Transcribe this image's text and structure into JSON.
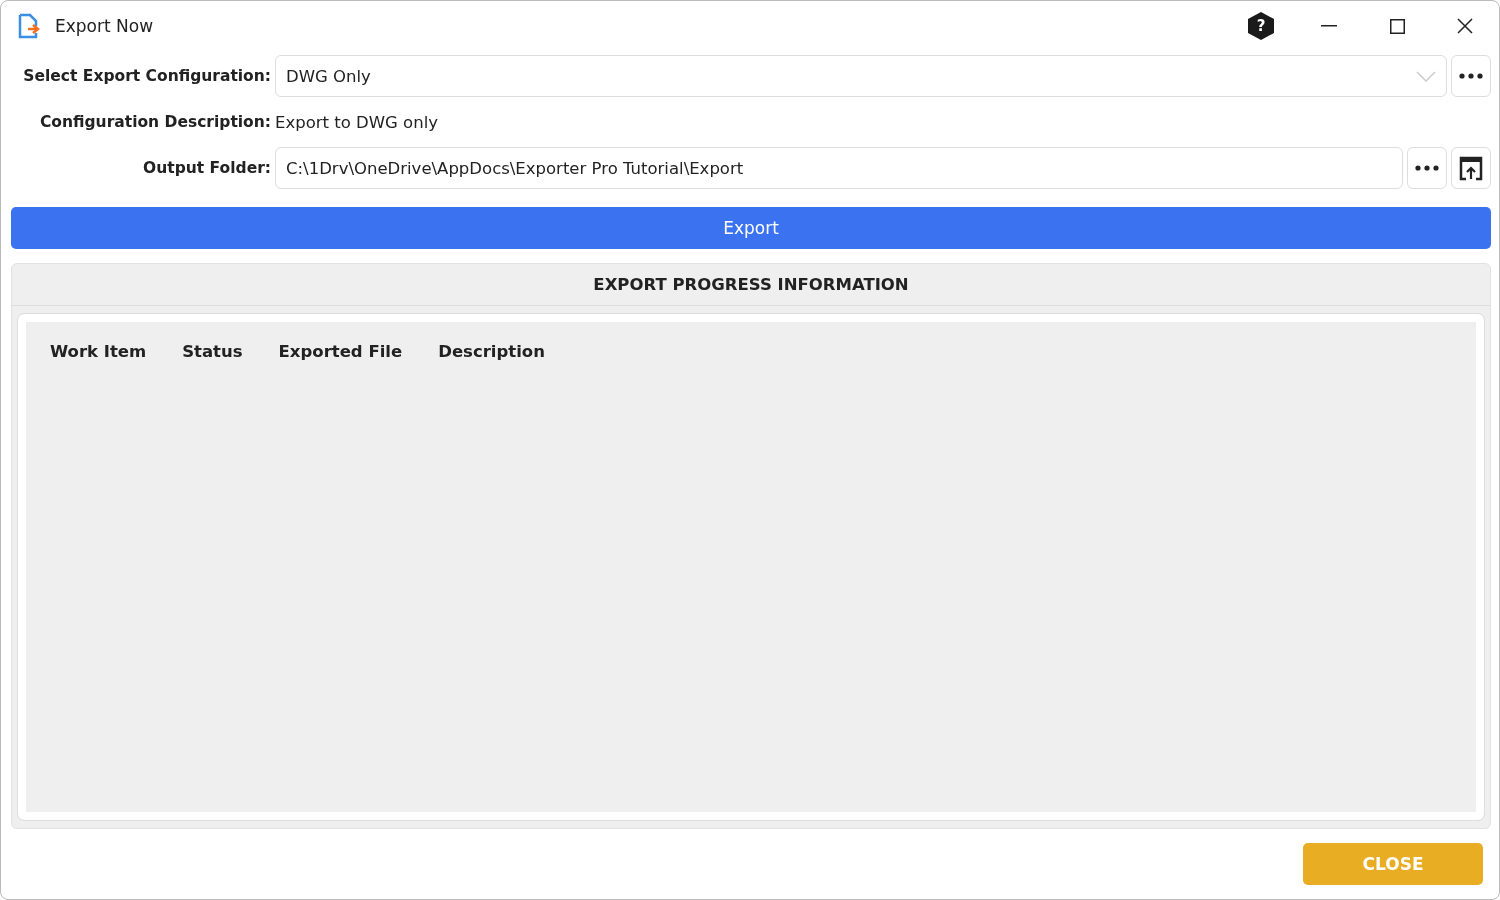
{
  "window": {
    "title": "Export Now",
    "help_button": "?"
  },
  "configuration": {
    "label": "Select Export Configuration:",
    "value": "DWG Only"
  },
  "description": {
    "label": "Configuration Description:",
    "value": "Export to DWG only"
  },
  "output_folder": {
    "label": "Output Folder:",
    "value": "C:\\1Drv\\OneDrive\\AppDocs\\Exporter Pro Tutorial\\Export"
  },
  "export_button": "Export",
  "progress": {
    "title": "EXPORT PROGRESS INFORMATION",
    "columns": [
      "Work Item",
      "Status",
      "Exported File",
      "Description"
    ]
  },
  "close_button": "CLOSE"
}
